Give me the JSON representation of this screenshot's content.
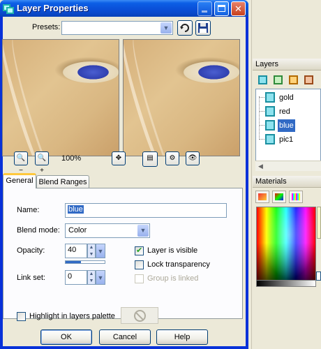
{
  "dialog": {
    "title": "Layer Properties",
    "presets": {
      "label": "Presets:",
      "value": ""
    },
    "zoom": "100%",
    "tabs": [
      {
        "label": "General",
        "selected": true
      },
      {
        "label": "Blend Ranges",
        "selected": false
      }
    ],
    "general": {
      "name_label": "Name:",
      "name_value": "blue",
      "blend_mode_label": "Blend mode:",
      "blend_mode_value": "Color",
      "opacity_label": "Opacity:",
      "opacity_value": "40",
      "opacity_fraction": 0.4,
      "link_set_label": "Link set:",
      "link_set_value": "0",
      "layer_visible_label": "Layer is visible",
      "layer_visible_checked": true,
      "lock_transparency_label": "Lock transparency",
      "lock_transparency_checked": false,
      "group_linked_label": "Group is linked",
      "group_linked_checked": false,
      "highlight_label": "Highlight in layers palette",
      "highlight_checked": false
    },
    "buttons": {
      "ok": "OK",
      "cancel": "Cancel",
      "help": "Help"
    }
  },
  "layers_panel": {
    "title": "Layers",
    "items": [
      {
        "name": "gold",
        "selected": false
      },
      {
        "name": "red",
        "selected": false
      },
      {
        "name": "blue",
        "selected": true
      },
      {
        "name": "pic1",
        "selected": false
      }
    ]
  },
  "materials_panel": {
    "title": "Materials"
  },
  "colors": {
    "titlebar": "#0a4fd8",
    "selection": "#316ac5",
    "tab_highlight": "#ffc83c",
    "check_green": "#21a121",
    "window_bg": "#ece9d8"
  },
  "icons": [
    "layer-properties-icon",
    "minimize-icon",
    "maximize-icon",
    "close-icon",
    "dropdown-arrow-icon",
    "load-preset-icon",
    "save-preset-icon",
    "zoom-out-icon",
    "zoom-in-icon",
    "pan-icon",
    "toggle-preview-icon",
    "proof-icon",
    "eye-icon",
    "no-icon"
  ]
}
